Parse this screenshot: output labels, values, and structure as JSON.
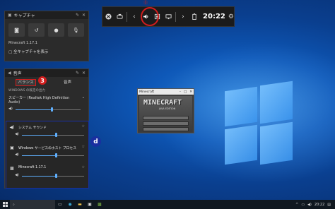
{
  "gamebar": {
    "time": "20:22",
    "icons": [
      "xbox-icon",
      "widget-icon",
      "chevron-left-icon",
      "audio-icon",
      "performance-icon",
      "monitor-icon",
      "chevron-right-icon",
      "battery-icon",
      "gear-icon"
    ],
    "annotation_text": "⓪"
  },
  "capture": {
    "title": "キャプチャ",
    "game_name": "Minecraft 1.17.1",
    "show_all_label": "全キャプチャを表示"
  },
  "audio": {
    "title": "音声",
    "tabs": [
      {
        "label": "バランス"
      },
      {
        "label": "音声"
      }
    ],
    "default_output_label": "WINDOWS の既定の出力",
    "device": "スピーカー (Realtek High Definition Audio)",
    "master_volume": 0.55,
    "apps": [
      {
        "name": "システム サウンド",
        "volume": 0.55
      },
      {
        "name": "Windows サービスのホスト プロセス",
        "volume": 0.55
      },
      {
        "name": "Minecraft 1.17.1",
        "volume": 0.55
      }
    ]
  },
  "annotations": {
    "badge_3": "3",
    "badge_d": "d"
  },
  "minecraft": {
    "window_title": "Minecraft",
    "logo": "MINECRAFT",
    "subtitle": "JAVA EDITION"
  },
  "taskbar": {
    "search_placeholder": "",
    "tray_time": "20:22"
  },
  "colors": {
    "accent": "#5fb0ff",
    "highlight_red": "#d21d1d",
    "annotation_blue": "#1a2fa0"
  }
}
